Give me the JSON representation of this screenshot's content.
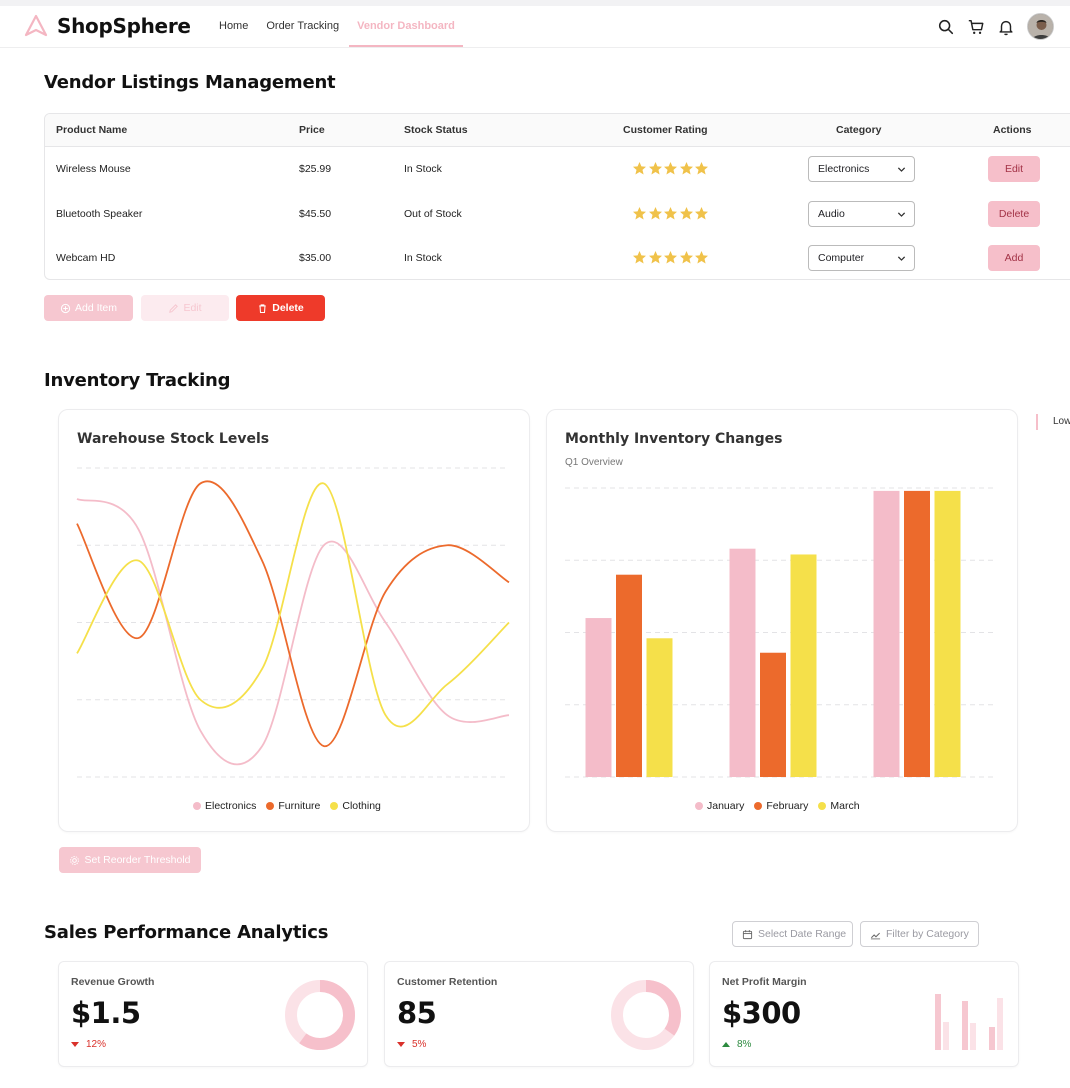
{
  "app": {
    "name": "ShopSphere",
    "nav": [
      "Home",
      "Order Tracking",
      "Vendor Dashboard"
    ],
    "active_nav": "Vendor Dashboard"
  },
  "listings": {
    "title": "Vendor Listings Management",
    "columns": [
      "Product Name",
      "Price",
      "Stock Status",
      "Customer Rating",
      "Category",
      "Actions"
    ],
    "rows": [
      {
        "name": "Wireless Mouse",
        "price": "$25.99",
        "status": "In Stock",
        "rating": 5,
        "category": "Electronics",
        "action": "Edit"
      },
      {
        "name": "Bluetooth Speaker",
        "price": "$45.50",
        "status": "Out of Stock",
        "rating": 5,
        "category": "Audio",
        "action": "Delete"
      },
      {
        "name": "Webcam HD",
        "price": "$35.00",
        "status": "In Stock",
        "rating": 5,
        "category": "Computer",
        "action": "Add"
      }
    ],
    "buttons": {
      "add": "Add Item",
      "edit": "Edit",
      "delete": "Delete"
    }
  },
  "inventory": {
    "title": "Inventory Tracking",
    "threshold_button": "Set Reorder Threshold",
    "side_label": "Low"
  },
  "chart_data": [
    {
      "type": "line",
      "title": "Warehouse Stock Levels",
      "x": [
        0,
        1,
        2,
        3,
        4,
        5,
        6,
        7
      ],
      "series": [
        {
          "name": "Electronics",
          "color": "#f4bcc9",
          "values": [
            90,
            80,
            15,
            10,
            75,
            50,
            20,
            20
          ]
        },
        {
          "name": "Furniture",
          "color": "#ec6a2c",
          "values": [
            82,
            45,
            95,
            70,
            10,
            60,
            75,
            63
          ]
        },
        {
          "name": "Clothing",
          "color": "#f5e04a",
          "values": [
            40,
            70,
            25,
            35,
            95,
            20,
            30,
            50
          ]
        }
      ],
      "grid": true,
      "legend": "bottom"
    },
    {
      "type": "bar",
      "title": "Monthly Inventory Changes",
      "subtitle": "Q1 Overview",
      "categories": [
        "",
        "",
        ""
      ],
      "series": [
        {
          "name": "January",
          "color": "#f4bcc9",
          "values": [
            55,
            79,
            99
          ]
        },
        {
          "name": "February",
          "color": "#ec6a2c",
          "values": [
            70,
            43,
            99
          ]
        },
        {
          "name": "March",
          "color": "#f5e04a",
          "values": [
            48,
            77,
            99
          ]
        }
      ],
      "ylim": [
        0,
        100
      ],
      "grid": true,
      "legend": "bottom"
    }
  ],
  "sales": {
    "title": "Sales Performance Analytics",
    "date_range": "Select Date Range",
    "filter": "Filter by Category",
    "kpis": [
      {
        "label": "Revenue Growth",
        "value": "$1.5",
        "delta": "12%",
        "direction": "down",
        "ring_fraction": 0.6
      },
      {
        "label": "Customer Retention",
        "value": "85",
        "delta": "5%",
        "direction": "down",
        "ring_fraction": 0.35
      },
      {
        "label": "Net Profit Margin",
        "value": "$300",
        "delta": "8%",
        "direction": "up"
      }
    ]
  },
  "colors": {
    "accent": "#f4b6c2",
    "danger": "#ee3a2a",
    "orange": "#ec6a2c",
    "yellow": "#f5e04a"
  }
}
